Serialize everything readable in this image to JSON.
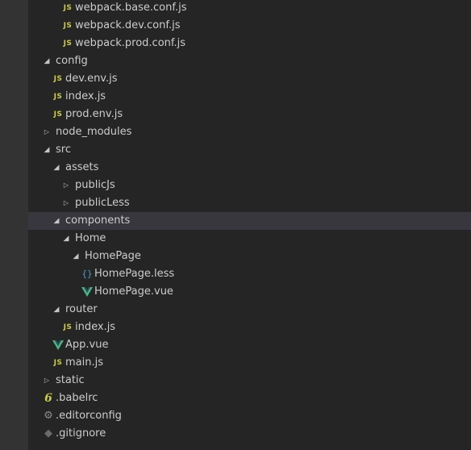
{
  "explorer": {
    "items": [
      {
        "label": "webpack.base.conf.js",
        "icon": "js-file-icon",
        "icon_text": "JS",
        "expanded": null
      },
      {
        "label": "webpack.dev.conf.js",
        "icon": "js-file-icon",
        "icon_text": "JS",
        "expanded": null
      },
      {
        "label": "webpack.prod.conf.js",
        "icon": "js-file-icon",
        "icon_text": "JS",
        "expanded": null
      },
      {
        "label": "config",
        "icon": null,
        "expanded": true
      },
      {
        "label": "dev.env.js",
        "icon": "js-file-icon",
        "icon_text": "JS",
        "expanded": null
      },
      {
        "label": "index.js",
        "icon": "js-file-icon",
        "icon_text": "JS",
        "expanded": null
      },
      {
        "label": "prod.env.js",
        "icon": "js-file-icon",
        "icon_text": "JS",
        "expanded": null
      },
      {
        "label": "node_modules",
        "icon": null,
        "expanded": false
      },
      {
        "label": "src",
        "icon": null,
        "expanded": true
      },
      {
        "label": "assets",
        "icon": null,
        "expanded": true
      },
      {
        "label": "publicJs",
        "icon": null,
        "expanded": false
      },
      {
        "label": "publicLess",
        "icon": null,
        "expanded": false
      },
      {
        "label": "components",
        "icon": null,
        "expanded": true,
        "selected": true
      },
      {
        "label": "Home",
        "icon": null,
        "expanded": true
      },
      {
        "label": "HomePage",
        "icon": null,
        "expanded": true
      },
      {
        "label": "HomePage.less",
        "icon": "less-file-icon",
        "icon_text": "{}",
        "expanded": null
      },
      {
        "label": "HomePage.vue",
        "icon": "vue-file-icon",
        "expanded": null
      },
      {
        "label": "router",
        "icon": null,
        "expanded": true
      },
      {
        "label": "index.js",
        "icon": "js-file-icon",
        "icon_text": "JS",
        "expanded": null
      },
      {
        "label": "App.vue",
        "icon": "vue-file-icon",
        "expanded": null
      },
      {
        "label": "main.js",
        "icon": "js-file-icon",
        "icon_text": "JS",
        "expanded": null
      },
      {
        "label": "static",
        "icon": null,
        "expanded": false
      },
      {
        "label": ".babelrc",
        "icon": "babel-file-icon",
        "icon_text": "6",
        "expanded": null
      },
      {
        "label": ".editorconfig",
        "icon": "gear-file-icon",
        "icon_text": "⚙",
        "expanded": null
      },
      {
        "label": ".gitignore",
        "icon": "git-file-icon",
        "icon_text": "◆",
        "expanded": null
      }
    ]
  },
  "colors": {
    "background": "#252526",
    "activity_bar": "#333333",
    "selection": "#37373d",
    "js": "#cbcb41",
    "vue": "#41b883",
    "less": "#519aba",
    "text": "#cccccc"
  }
}
